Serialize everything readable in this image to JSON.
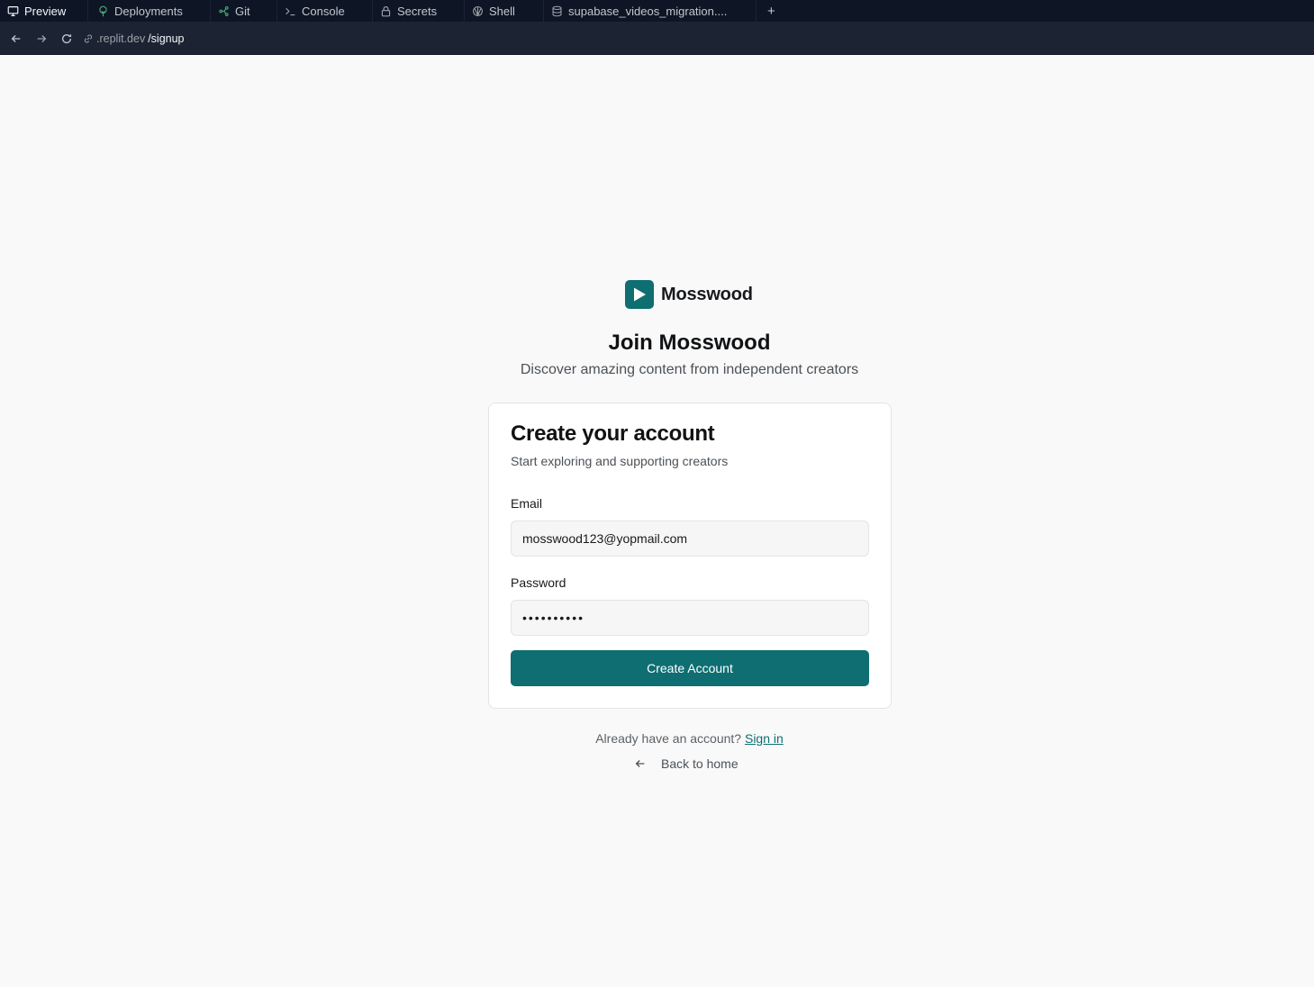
{
  "tabs": [
    {
      "label": "Preview",
      "icon": "monitor-icon",
      "active": true
    },
    {
      "label": "Deployments",
      "icon": "deployments-icon"
    },
    {
      "label": "Git",
      "icon": "git-icon"
    },
    {
      "label": "Console",
      "icon": "terminal-icon"
    },
    {
      "label": "Secrets",
      "icon": "lock-icon"
    },
    {
      "label": "Shell",
      "icon": "shell-icon"
    },
    {
      "label": "supabase_videos_migration....",
      "icon": "database-icon"
    }
  ],
  "add_tab_label": "+",
  "urlbar": {
    "domain": ".replit.dev",
    "path": "/signup"
  },
  "brand": {
    "name": "Mosswood",
    "color": "#0e6e72"
  },
  "hero": {
    "title": "Join Mosswood",
    "subtitle": "Discover amazing content from independent creators"
  },
  "card": {
    "title": "Create your account",
    "subtitle": "Start exploring and supporting creators",
    "email_label": "Email",
    "email_value": "mosswood123@yopmail.com",
    "password_label": "Password",
    "password_value": "••••••••••",
    "submit_label": "Create Account"
  },
  "footer": {
    "prompt": "Already have an account?",
    "signin_label": "Sign in",
    "back_label": "Back to home"
  }
}
